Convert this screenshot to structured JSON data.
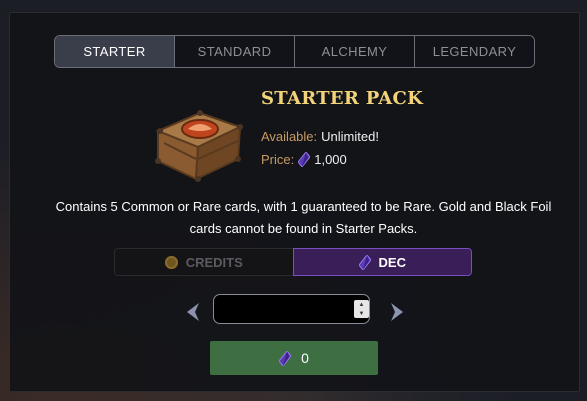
{
  "tabs": [
    {
      "label": "STARTER",
      "active": true
    },
    {
      "label": "STANDARD",
      "active": false
    },
    {
      "label": "ALCHEMY",
      "active": false
    },
    {
      "label": "LEGENDARY",
      "active": false
    }
  ],
  "pack": {
    "title": "STARTER PACK",
    "available_label": "Available:",
    "available_value": "Unlimited!",
    "price_label": "Price:",
    "price_value": "1,000",
    "chest_icon": "treasure-chest-icon",
    "price_icon": "dec-gem-icon"
  },
  "description": "Contains 5 Common or Rare cards, with 1 guaranteed to be Rare. Gold and Black Foil cards cannot be found in Starter Packs.",
  "currency": {
    "options": [
      {
        "label": "CREDITS",
        "icon": "credits-coin-icon",
        "selected": false
      },
      {
        "label": "DEC",
        "icon": "dec-gem-icon",
        "selected": true
      }
    ]
  },
  "quantity": {
    "value": "",
    "prev_icon": "chevron-left-icon",
    "next_icon": "chevron-right-icon"
  },
  "buy": {
    "total": "0",
    "icon": "dec-gem-icon"
  },
  "colors": {
    "accent_gold": "#f2d37a",
    "label_tan": "#c69a63",
    "dec_purple": "#3a1e58",
    "buy_green": "#3d6f43",
    "tab_active": "#3a3d4a"
  }
}
